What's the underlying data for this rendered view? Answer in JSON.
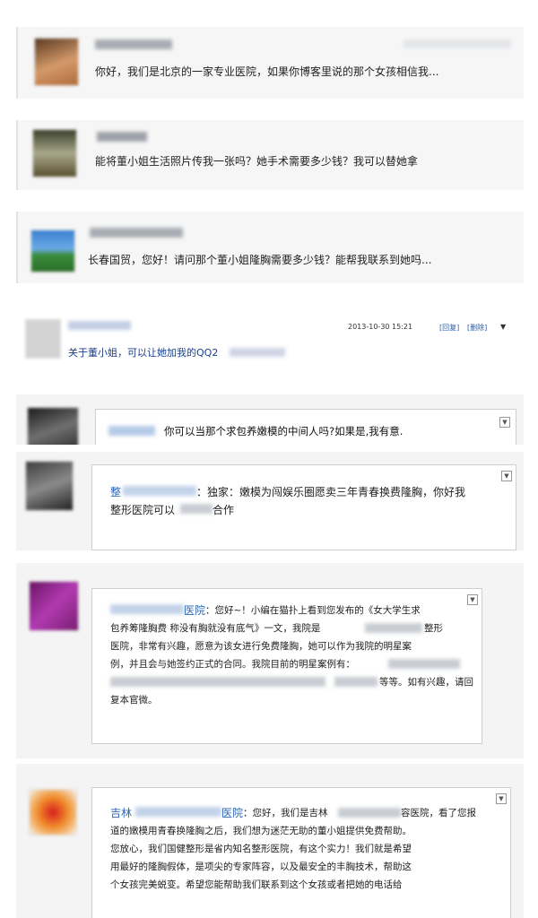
{
  "comments": [
    {
      "text": "你好，我们是北京的一家专业医院，如果你博客里说的那个女孩相信我..."
    },
    {
      "text": "能将董小姐生活照片传我一张吗？她手术需要多少钱？我可以替她拿"
    },
    {
      "text": "长春国贸，您好！请问那个董小姐隆胸需要多少钱？能帮我联系到她吗..."
    },
    {
      "text": "关于董小姐，可以让她加我的QQ2",
      "timestamp": "2013-10-30 15:21",
      "reply_label": "[回复]",
      "delete_label": "[删除]",
      "menu_glyph": "▼"
    },
    {
      "text": "你可以当那个求包养嫩模的中间人吗?如果是,我有意."
    },
    {
      "name_prefix": "整",
      "text_line1": "：独家：嫩模为闯娱乐圈愿卖三年青春换费隆胸，你好我",
      "text_line2a": "整形医院可以",
      "text_line2b": "合作"
    },
    {
      "name_suffix": "医院",
      "text_line1": "：您好~！小编在猫扑上看到您发布的《女大学生求",
      "text_line2": "包养筹隆胸费 称没有胸就没有底气》一文，我院是",
      "text_line2b": "整形",
      "text_line3": "医院，非常有兴趣，愿意为该女进行免费隆胸，她可以作为我院的明星案",
      "text_line4": "例，并且会与她签约正式的合同。我院目前的明星案例有：",
      "text_line5": "等等。如有兴趣，请回",
      "text_line6": "复本官微。"
    },
    {
      "name_prefix": "吉林",
      "name_suffix": "医院",
      "text_line1": "：您好，我们是吉林",
      "text_line1b": "容医院，看了您报",
      "text_line2": "道的嫩模用青春换隆胸之后，我们想为迷茫无助的董小姐提供免费帮助。",
      "text_line3": "您放心，我们国健整形是省内知名整形医院，有这个实力！我们就是希望",
      "text_line4": "用最好的隆胸假体，是项尖的专家阵容，以及最安全的丰胸技术，帮助这",
      "text_line5": "个女孩完美蜕变。希望您能帮助我们联系到这个女孩或者把她的电话给"
    }
  ],
  "dropdown_glyph": "▼"
}
